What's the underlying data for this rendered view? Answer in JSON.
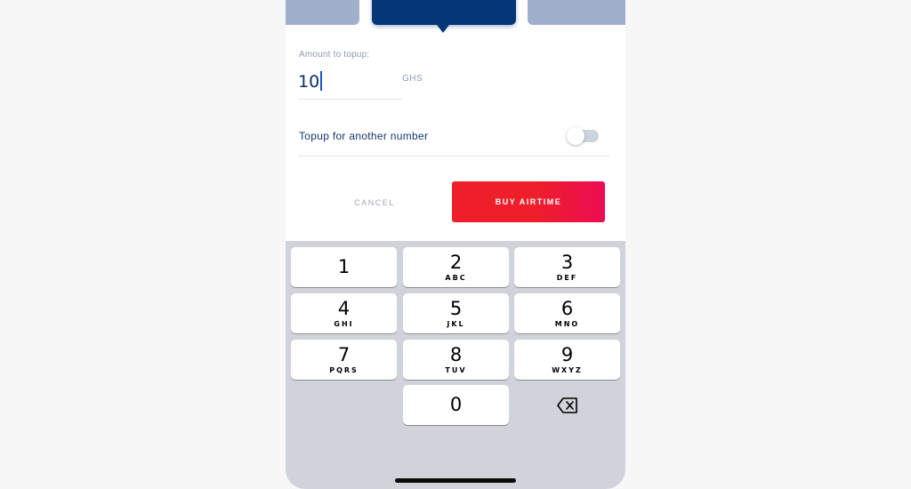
{
  "form": {
    "amount_label": "Amount to topup:",
    "amount_value": "10",
    "currency": "GHS",
    "toggle_label": "Topup for another number",
    "toggle_on": false
  },
  "actions": {
    "cancel_label": "CANCEL",
    "buy_label": "BUY AIRTIME"
  },
  "colors": {
    "brand_blue": "#053677",
    "buy_red": "#ee1e2a",
    "buy_pink": "#ec0c55"
  },
  "keypad": {
    "keys": [
      {
        "digit": "1",
        "letters": ""
      },
      {
        "digit": "2",
        "letters": "ABC"
      },
      {
        "digit": "3",
        "letters": "DEF"
      },
      {
        "digit": "4",
        "letters": "GHI"
      },
      {
        "digit": "5",
        "letters": "JKL"
      },
      {
        "digit": "6",
        "letters": "MNO"
      },
      {
        "digit": "7",
        "letters": "PQRS"
      },
      {
        "digit": "8",
        "letters": "TUV"
      },
      {
        "digit": "9",
        "letters": "WXYZ"
      },
      {
        "digit": "0",
        "letters": ""
      }
    ],
    "backspace_icon": "backspace-icon"
  }
}
